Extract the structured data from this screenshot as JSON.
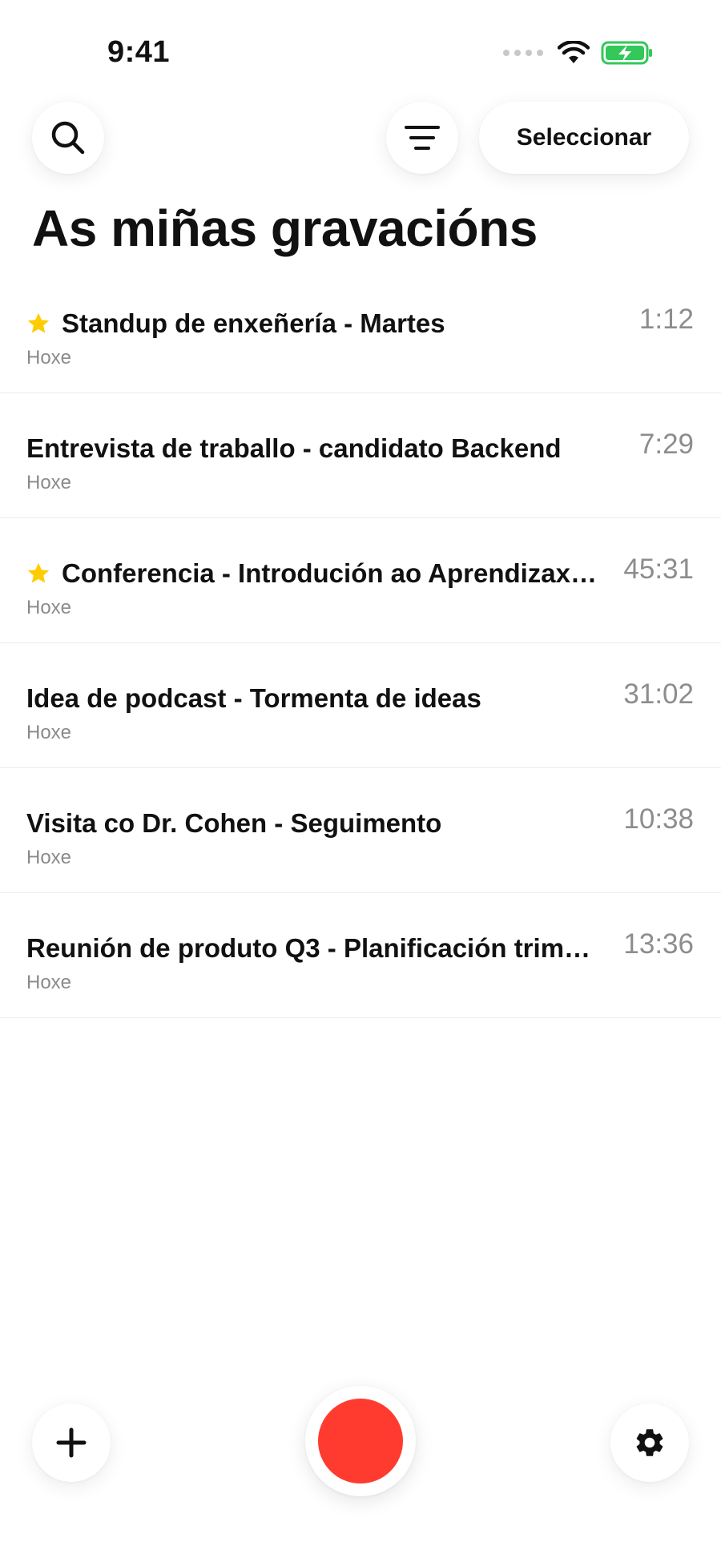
{
  "status_bar": {
    "time": "9:41"
  },
  "header": {
    "search_icon": "search-icon",
    "filter_icon": "filter-icon",
    "select_label": "Seleccionar"
  },
  "page": {
    "title": "As miñas gravacións"
  },
  "recordings": [
    {
      "starred": true,
      "title": "Standup de enxeñería - Martes",
      "date": "Hoxe",
      "duration": "1:12"
    },
    {
      "starred": false,
      "title": "Entrevista de traballo - candidato Backend",
      "date": "Hoxe",
      "duration": "7:29"
    },
    {
      "starred": true,
      "title": "Conferencia - Introdución ao Aprendizaxe...",
      "date": "Hoxe",
      "duration": "45:31"
    },
    {
      "starred": false,
      "title": "Idea de podcast - Tormenta de ideas",
      "date": "Hoxe",
      "duration": "31:02"
    },
    {
      "starred": false,
      "title": "Visita co Dr. Cohen - Seguimento",
      "date": "Hoxe",
      "duration": "10:38"
    },
    {
      "starred": false,
      "title": "Reunión de produto Q3 - Planificación trimes...",
      "date": "Hoxe",
      "duration": "13:36"
    }
  ],
  "bottom_bar": {
    "add_icon": "plus-icon",
    "record_icon": "record-icon",
    "settings_icon": "gear-icon"
  },
  "colors": {
    "star": "#ffcc00",
    "record": "#ff3b30",
    "battery": "#34c759"
  }
}
